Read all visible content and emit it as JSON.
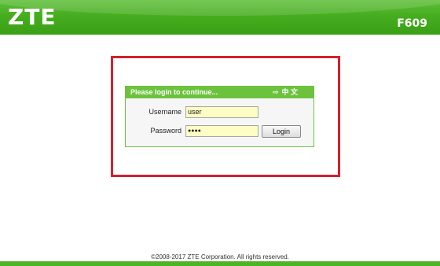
{
  "header": {
    "brand": "ZTE",
    "model": "F609",
    "color": "#46ad1f"
  },
  "highlight": {
    "color": "#d6202a"
  },
  "login": {
    "title": "Please login to continue...",
    "language_icon": "arrow-icon",
    "language_label": "中 文",
    "username_label": "Username",
    "username_value": "user",
    "password_label": "Password",
    "password_value": "●●●●",
    "login_button": "Login"
  },
  "footer": {
    "copyright": "©2008-2017 ZTE Corporation. All rights reserved."
  }
}
